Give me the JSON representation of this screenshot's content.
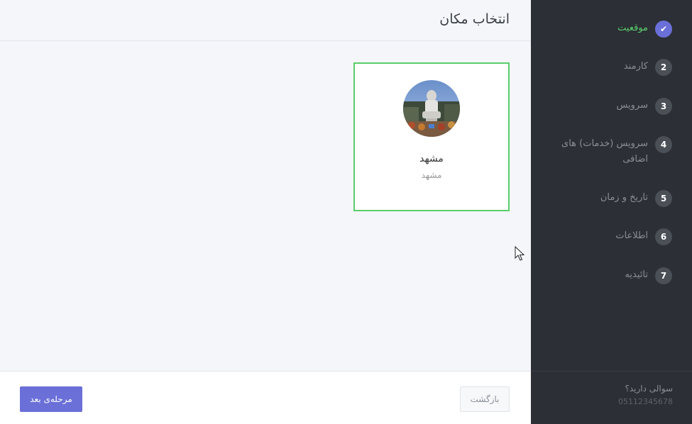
{
  "header": {
    "title": "انتخاب مکان"
  },
  "location_card": {
    "title": "مشهد",
    "subtitle": "مشهد",
    "photo_icon": "location-photo"
  },
  "footer": {
    "next_label": "مرحله‌ی بعد",
    "back_label": "بازگشت"
  },
  "sidebar": {
    "steps": [
      {
        "badge": "✔",
        "label": "موقعیت",
        "state": "done"
      },
      {
        "badge": "2",
        "label": "کارمند",
        "state": "pending"
      },
      {
        "badge": "3",
        "label": "سرویس",
        "state": "pending"
      },
      {
        "badge": "4",
        "label": "سرویس (خدمات) های اضافی",
        "state": "pending"
      },
      {
        "badge": "5",
        "label": "تاریخ و زمان",
        "state": "pending"
      },
      {
        "badge": "6",
        "label": "اطلاعات",
        "state": "pending"
      },
      {
        "badge": "7",
        "label": "تائیدیه",
        "state": "pending"
      }
    ],
    "help_question": "سوالی دارید؟",
    "help_phone": "05112345678"
  },
  "colors": {
    "accent": "#6b6fd8",
    "selected_border": "#5ace6b",
    "active_step_text": "#5ace6b",
    "sidebar_bg": "#2c2f35"
  }
}
